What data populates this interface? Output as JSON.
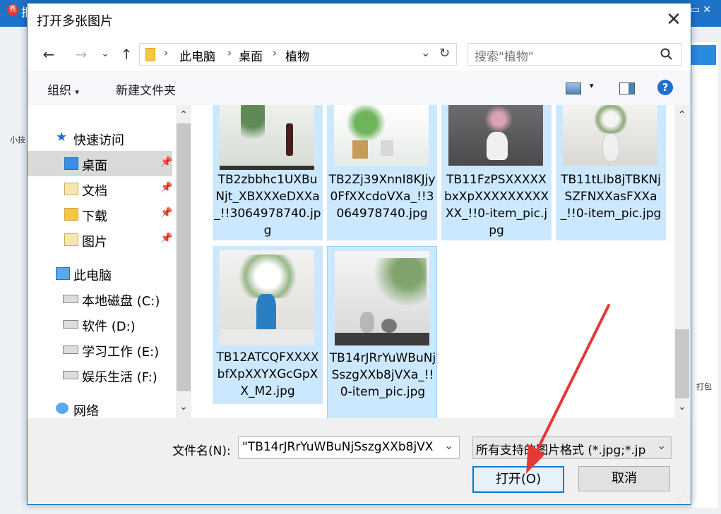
{
  "background_app": {
    "title": "报",
    "left_text": "小技",
    "right_text": "打包"
  },
  "dialog": {
    "title": "打开多张图片",
    "close_icon": "close-icon"
  },
  "nav": {
    "breadcrumb": [
      "此电脑",
      "桌面",
      "植物"
    ],
    "search_placeholder": "搜索\"植物\""
  },
  "toolbar": {
    "organize_label": "组织",
    "new_folder_label": "新建文件夹"
  },
  "sidebar": {
    "quick_access": "快速访问",
    "quick_items": [
      {
        "label": "桌面"
      },
      {
        "label": "文档"
      },
      {
        "label": "下载"
      },
      {
        "label": "图片"
      }
    ],
    "this_pc": "此电脑",
    "drives": [
      {
        "label": "本地磁盘 (C:)"
      },
      {
        "label": "软件 (D:)"
      },
      {
        "label": "学习工作 (E:)"
      },
      {
        "label": "娱乐生活 (F:)"
      }
    ],
    "network": "网络"
  },
  "files": [
    {
      "name": "TB2zbbhc1UXBuNjt_XBXXXeDXXa_!!3064978740.jpg"
    },
    {
      "name": "TB2Zj39XnnI8KJjy0FfXXcdoVXa_!!3064978740.jpg"
    },
    {
      "name": "TB11FzPSXXXXXbxXpXXXXXXXXXXX_!!0-item_pic.jpg"
    },
    {
      "name": "TB11tLIb8jTBKNjSZFNXXasFXXa_!!0-item_pic.jpg"
    },
    {
      "name": "TB12ATCQFXXXXbfXpXXYXGcGpXX_M2.jpg"
    },
    {
      "name": "TB14rJRrYuWBuNjSszgXXb8jVXa_!!0-item_pic.jpg"
    }
  ],
  "bottom": {
    "filename_label": "文件名(N):",
    "filename_value": "\"TB14rJRrYuWBuNjSszgXXb8jVX",
    "filetype_value": "所有支持的图片格式 (*.jpg;*.jp",
    "open_label": "打开(O)",
    "cancel_label": "取消"
  },
  "colors": {
    "accent": "#0078d7",
    "selection": "#cce8ff",
    "annotation_arrow": "#e53935"
  }
}
